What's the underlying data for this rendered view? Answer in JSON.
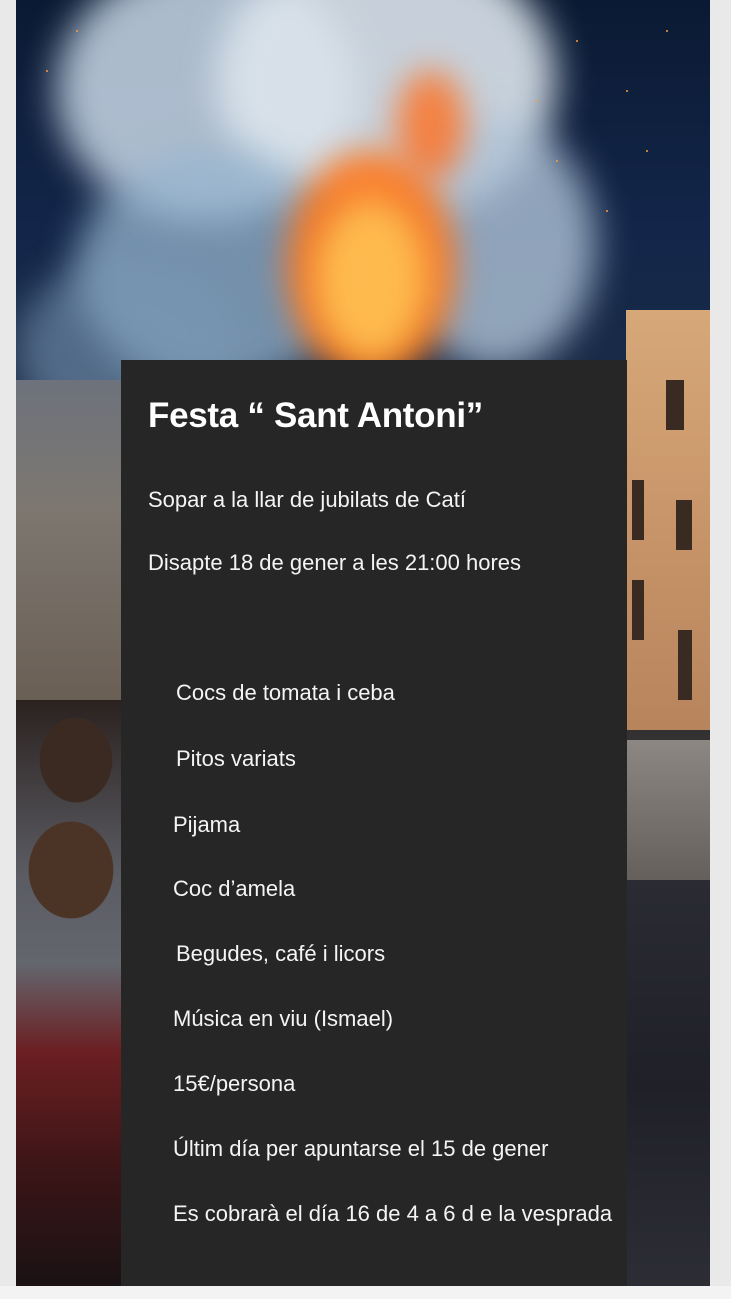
{
  "poster": {
    "title": "Festa “ Sant Antoni”",
    "subtitle": "Sopar a la llar de jubilats de Catí",
    "date": "Disapte 18 de gener a les 21:00 hores",
    "menu_items": [
      "Cocs de tomata i ceba",
      "Pitos variats",
      "Pijama",
      "Coc  d’amela",
      "Begudes, café i licors",
      "Música en viu (Ismael)",
      "15€/persona",
      "Últim día per apuntarse el 15 de gener",
      "Es cobrarà el día 16 de 4 a 6 d e la vesprada"
    ]
  },
  "colors": {
    "panel_bg": "#262626",
    "text": "#ffffff",
    "sky": "#0b1a33",
    "fire": "#ff7a1a"
  }
}
